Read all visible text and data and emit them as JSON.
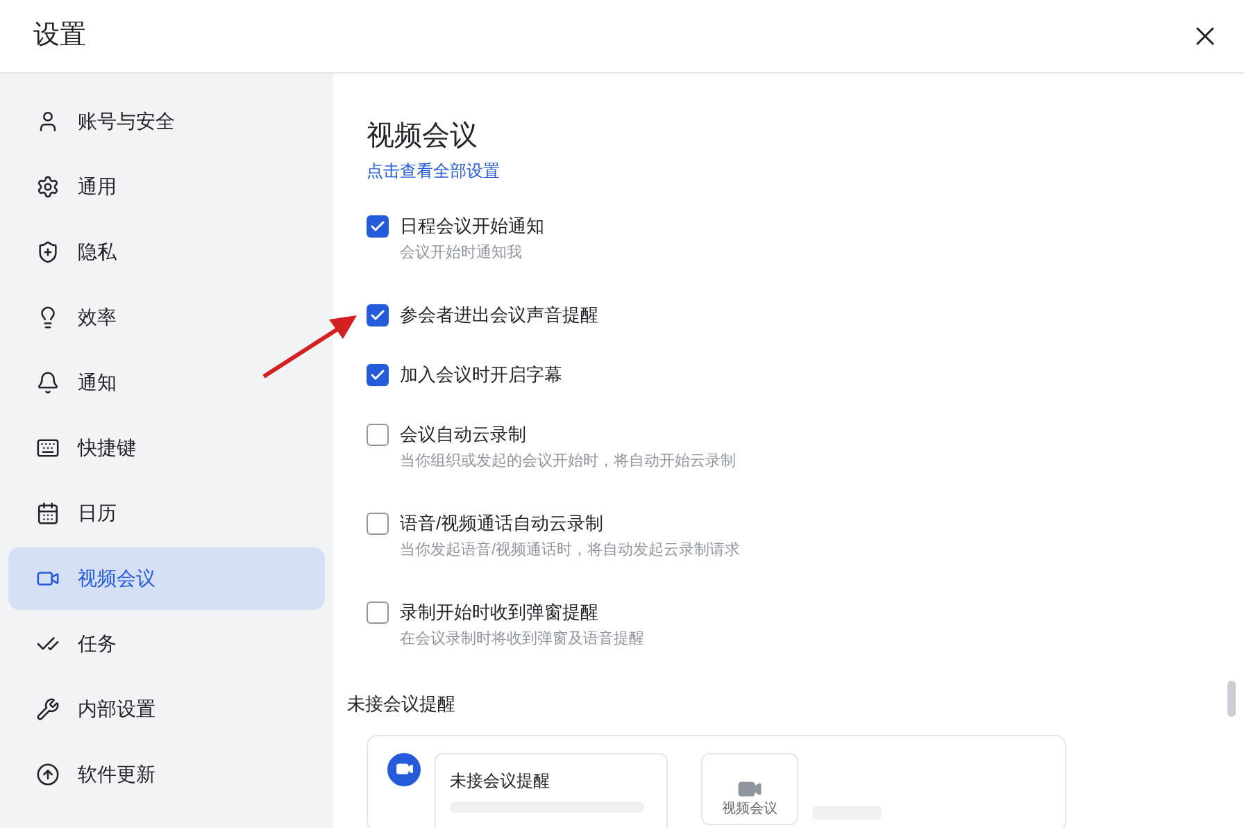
{
  "window": {
    "title": "设置"
  },
  "sidebar": {
    "items": [
      {
        "label": "账号与安全",
        "selected": false
      },
      {
        "label": "通用",
        "selected": false
      },
      {
        "label": "隐私",
        "selected": false
      },
      {
        "label": "效率",
        "selected": false
      },
      {
        "label": "通知",
        "selected": false
      },
      {
        "label": "快捷键",
        "selected": false
      },
      {
        "label": "日历",
        "selected": false
      },
      {
        "label": "视频会议",
        "selected": true
      },
      {
        "label": "任务",
        "selected": false
      },
      {
        "label": "内部设置",
        "selected": false
      },
      {
        "label": "软件更新",
        "selected": false
      }
    ]
  },
  "content": {
    "title": "视频会议",
    "link": "点击查看全部设置",
    "options": [
      {
        "label": "日程会议开始通知",
        "description": "会议开始时通知我",
        "checked": true
      },
      {
        "label": "参会者进出会议声音提醒",
        "checked": true
      },
      {
        "label": "加入会议时开启字幕",
        "checked": true
      },
      {
        "label": "会议自动云录制",
        "description": "当你组织或发起的会议开始时，将自动开始云录制",
        "checked": false
      },
      {
        "label": "语音/视频通话自动云录制",
        "description": "当你发起语音/视频通话时，将自动发起云录制请求",
        "checked": false
      },
      {
        "label": "录制开始时收到弹窗提醒",
        "description": "在会议录制时将收到弹窗及语音提醒",
        "checked": false
      }
    ],
    "section": {
      "title": "未接会议提醒",
      "preview_title": "未接会议提醒",
      "preview_app_label": "视频会议"
    }
  }
}
